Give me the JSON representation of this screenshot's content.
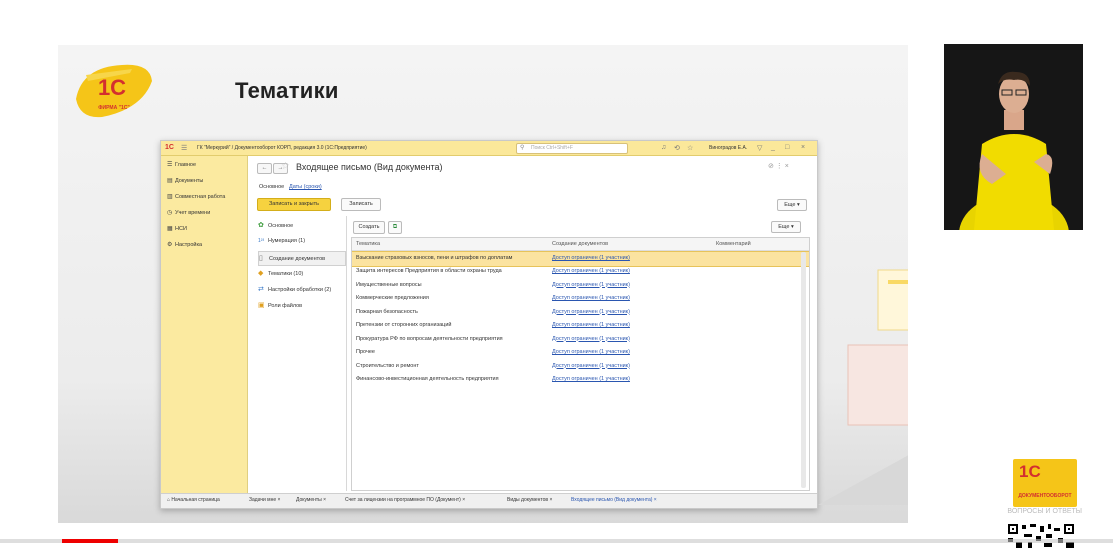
{
  "slide": {
    "title": "Тематики",
    "logo_text": "1С",
    "logo_sub": "ФИРМА \"1С\""
  },
  "window": {
    "app_logo": "1С",
    "title": "ГК \"Меркурий\" / Документооборот КОРП, редакция 3.0 (1С:Предприятие)",
    "search_placeholder": "Поиск Ctrl+Shift+F",
    "user": "Виноградов Е.А.",
    "form_title": "Входящее письмо (Вид документа)",
    "tabs": {
      "main": "Основное",
      "dates": "Даты (сроки)"
    },
    "buttons": {
      "save_close": "Записать и закрыть",
      "save": "Записать",
      "more": "Еще ▾",
      "create": "Создать",
      "more2": "Еще ▾"
    }
  },
  "sidebar": {
    "items": [
      {
        "icon": "menu-icon",
        "label": "Главное"
      },
      {
        "icon": "documents-icon",
        "label": "Документы"
      },
      {
        "icon": "collab-icon",
        "label": "Совместная работа"
      },
      {
        "icon": "clock-icon",
        "label": "Учет времени"
      },
      {
        "icon": "nsi-icon",
        "label": "НСИ"
      },
      {
        "icon": "settings-icon",
        "label": "Настройка"
      }
    ]
  },
  "nav": {
    "items": [
      {
        "icon": "gear-icon",
        "label": "Основное"
      },
      {
        "icon": "numbering-icon",
        "label": "Нумерация (1)"
      },
      {
        "icon": "doc-create-icon",
        "label": "Создание документов"
      },
      {
        "icon": "tag-icon",
        "label": "Тематики (10)"
      },
      {
        "icon": "processing-icon",
        "label": "Настройки обработки (2)"
      },
      {
        "icon": "files-icon",
        "label": "Роли файлов"
      }
    ],
    "selected": 2
  },
  "grid": {
    "columns": [
      "Тематика",
      "Создание документов",
      "Комментарий"
    ],
    "rows": [
      {
        "topic": "Взыскание страховых взносов, пени и штрафов по доплатам",
        "access": "Доступ ограничен (1 участник)"
      },
      {
        "topic": "Защита интересов Предприятия в области охраны труда",
        "access": "Доступ ограничен (1 участник)"
      },
      {
        "topic": "Имущественные вопросы",
        "access": "Доступ ограничен (1 участник)"
      },
      {
        "topic": "Коммерческие предложения",
        "access": "Доступ ограничен (1 участник)"
      },
      {
        "topic": "Пожарная безопасность",
        "access": "Доступ ограничен (1 участник)"
      },
      {
        "topic": "Претензии от сторонних организаций",
        "access": "Доступ ограничен (1 участник)"
      },
      {
        "topic": "Прокуратура РФ по вопросам деятельности предприятия",
        "access": "Доступ ограничен (1 участник)"
      },
      {
        "topic": "Прочее",
        "access": "Доступ ограничен (1 участник)"
      },
      {
        "topic": "Строительство и ремонт",
        "access": "Доступ ограничен (1 участник)"
      },
      {
        "topic": "Финансово-инвестиционная деятельность предприятия",
        "access": "Доступ ограничен (1 участник)"
      }
    ]
  },
  "taskbar": {
    "items": [
      "Начальная страница",
      "Задачи мне ×",
      "Документы ×",
      "Счет за лицензии на программное ПО (Документ) ×",
      "Виды документов ×",
      "Входящее письмо (Вид документа) ×"
    ]
  },
  "brand": {
    "logo": "1С",
    "name": "ДОКУМЕНТООБОРОТ",
    "subtitle": "ВОПРОСЫ И ОТВЕТЫ"
  },
  "colors": {
    "accent": "#f6d23f",
    "sidebar": "#fbeaa0",
    "link": "#2a56b0",
    "progress": "#e00000"
  },
  "video": {
    "progress": 0.05
  }
}
